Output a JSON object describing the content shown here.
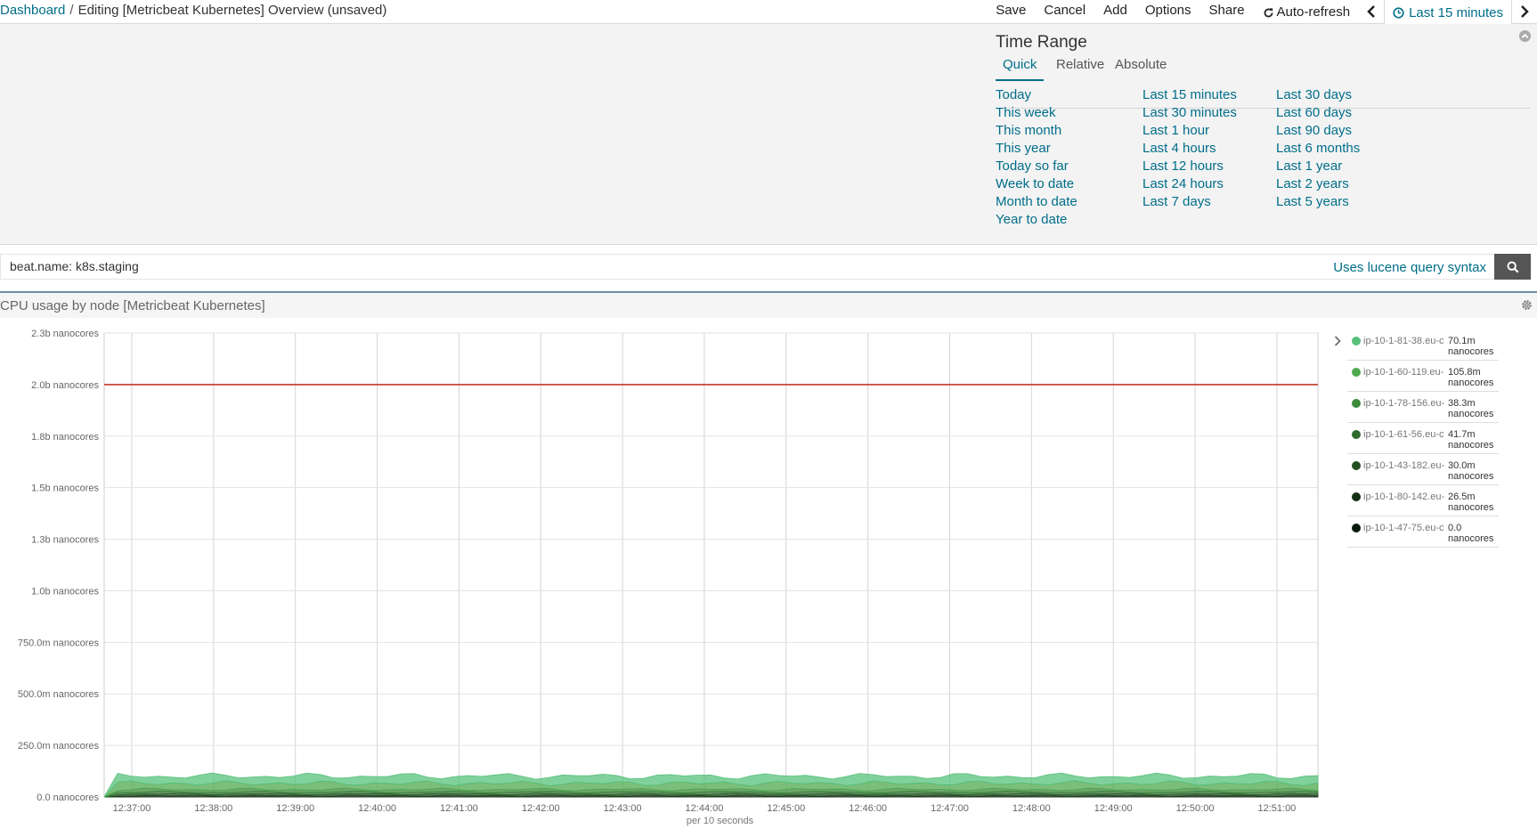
{
  "breadcrumb": {
    "root": "Dashboard",
    "separator": "/",
    "current": "Editing [Metricbeat Kubernetes] Overview (unsaved)"
  },
  "menu": {
    "save": "Save",
    "cancel": "Cancel",
    "add": "Add",
    "options": "Options",
    "share": "Share",
    "auto_refresh": "Auto-refresh",
    "time_picker": "Last 15 minutes"
  },
  "time_range": {
    "title": "Time Range",
    "tabs": [
      "Quick",
      "Relative",
      "Absolute"
    ],
    "active_tab": "Quick",
    "col1": [
      "Today",
      "This week",
      "This month",
      "This year",
      "Today so far",
      "Week to date",
      "Month to date",
      "Year to date"
    ],
    "col2": [
      "Last 15 minutes",
      "Last 30 minutes",
      "Last 1 hour",
      "Last 4 hours",
      "Last 12 hours",
      "Last 24 hours",
      "Last 7 days"
    ],
    "col3": [
      "Last 30 days",
      "Last 60 days",
      "Last 90 days",
      "Last 6 months",
      "Last 1 year",
      "Last 2 years",
      "Last 5 years"
    ]
  },
  "query": {
    "value": "beat.name: k8s.staging",
    "syntax_link": "Uses lucene query syntax"
  },
  "visualization": {
    "title": "CPU usage by node [Metricbeat Kubernetes]"
  },
  "colors": {
    "link": "#006e8a",
    "threshold": "#c0392b"
  },
  "chart_data": {
    "type": "area",
    "y_tick_labels": [
      "0.0 nanocores",
      "250.0m nanocores",
      "500.0m nanocores",
      "750.0m nanocores",
      "1.0b nanocores",
      "1.3b nanocores",
      "1.5b nanocores",
      "1.8b nanocores",
      "2.0b nanocores",
      "2.3b nanocores"
    ],
    "y_tick_values": [
      0,
      0.25,
      0.5,
      0.75,
      1.0,
      1.25,
      1.5,
      1.75,
      2.0,
      2.25
    ],
    "ylim": [
      0,
      2.25
    ],
    "x_tick_labels": [
      "12:37:00",
      "12:38:00",
      "12:39:00",
      "12:40:00",
      "12:41:00",
      "12:42:00",
      "12:43:00",
      "12:44:00",
      "12:45:00",
      "12:46:00",
      "12:47:00",
      "12:48:00",
      "12:49:00",
      "12:50:00",
      "12:51:00"
    ],
    "xlabel": "per 10 seconds",
    "threshold": 2.0,
    "grid": true,
    "legend_position": "right",
    "series": [
      {
        "name": "ip-10-1-81-38.eu-c",
        "value_label": "70.1m",
        "unit": "nanocores",
        "color": "#57c17b",
        "approx_level": 0.035
      },
      {
        "name": "ip-10-1-60-119.eu-",
        "value_label": "105.8m",
        "unit": "nanocores",
        "color": "#4fa84f",
        "approx_level": 0.03
      },
      {
        "name": "ip-10-1-78-156.eu-",
        "value_label": "38.3m",
        "unit": "nanocores",
        "color": "#3d8a3d",
        "approx_level": 0.012
      },
      {
        "name": "ip-10-1-61-56.eu-c",
        "value_label": "41.7m",
        "unit": "nanocores",
        "color": "#2e6b2e",
        "approx_level": 0.01
      },
      {
        "name": "ip-10-1-43-182.eu-",
        "value_label": "30.0m",
        "unit": "nanocores",
        "color": "#234f23",
        "approx_level": 0.008
      },
      {
        "name": "ip-10-1-80-142.eu-",
        "value_label": "26.5m",
        "unit": "nanocores",
        "color": "#163016",
        "approx_level": 0.006
      },
      {
        "name": "ip-10-1-47-75.eu-c",
        "value_label": "0.0",
        "unit": "nanocores",
        "color": "#0a1a0a",
        "approx_level": 0.0
      }
    ]
  }
}
